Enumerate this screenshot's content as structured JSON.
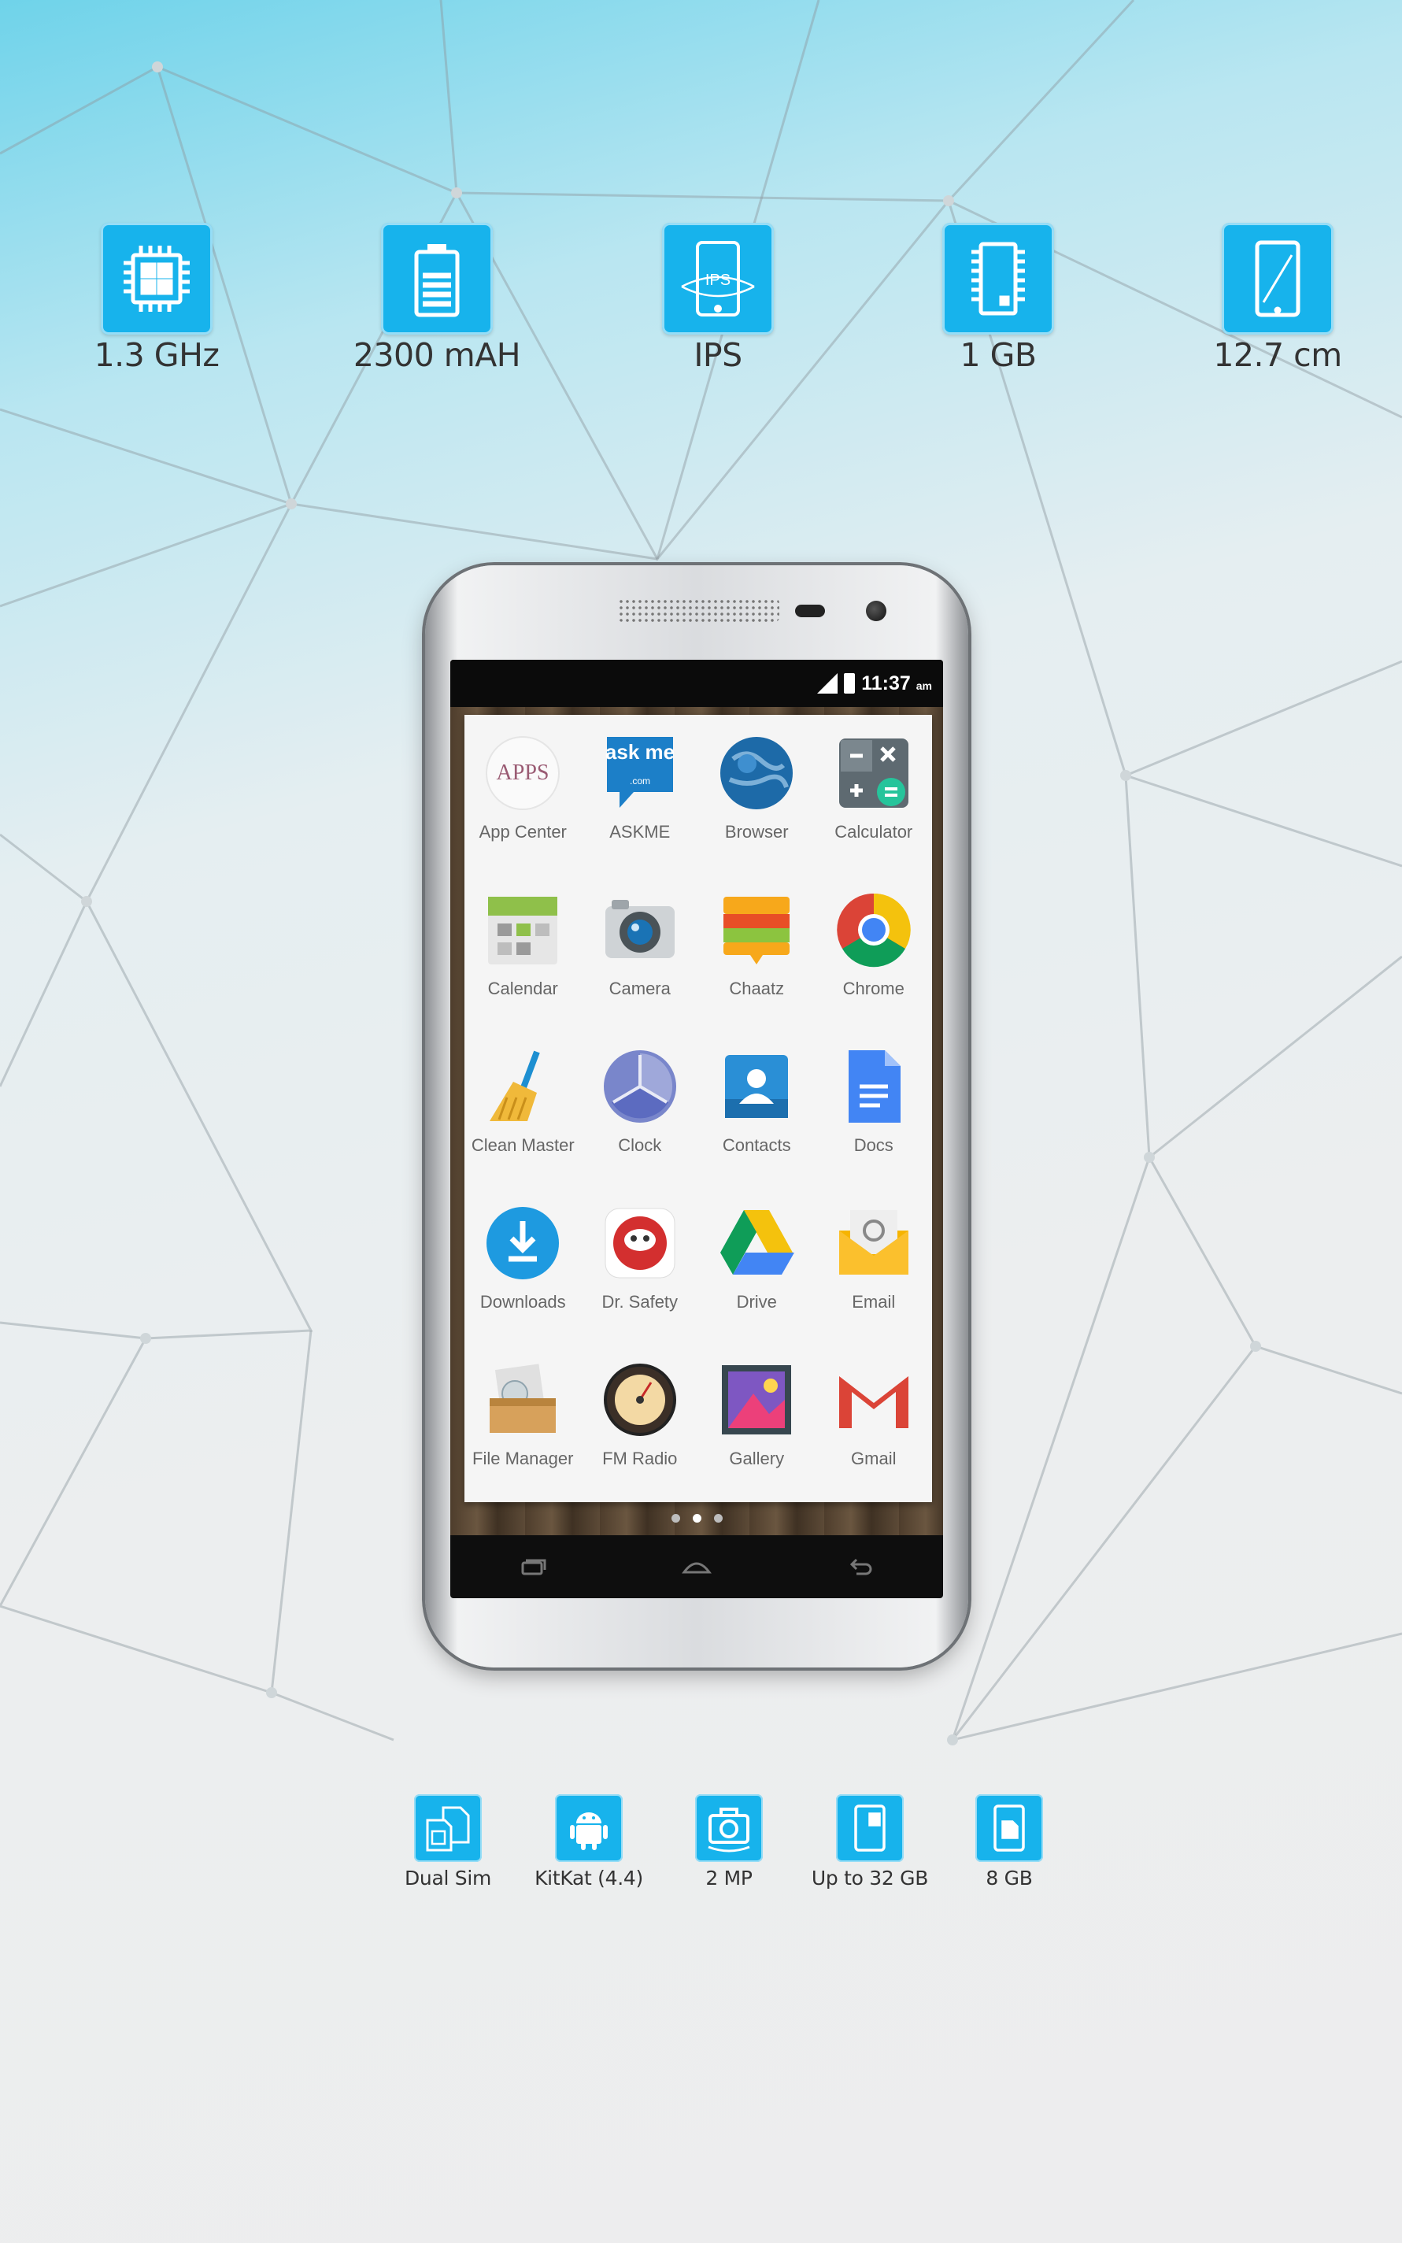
{
  "top_specs": [
    {
      "icon": "processor-chip-icon",
      "label": "1.3 GHz"
    },
    {
      "icon": "battery-icon",
      "label": "2300 mAH"
    },
    {
      "icon": "ips-display-icon",
      "label": "IPS",
      "icon_text": "IPS"
    },
    {
      "icon": "memory-ram-icon",
      "label": "1 GB"
    },
    {
      "icon": "screen-size-icon",
      "label": "12.7 cm"
    }
  ],
  "bottom_specs": [
    {
      "icon": "dual-sim-icon",
      "label": "Dual Sim"
    },
    {
      "icon": "android-icon",
      "label": "KitKat (4.4)"
    },
    {
      "icon": "front-camera-icon",
      "label": "2 MP"
    },
    {
      "icon": "expandable-memory-icon",
      "label": "Up to 32 GB"
    },
    {
      "icon": "storage-card-icon",
      "label": "8 GB"
    }
  ],
  "phone": {
    "status_time": "11:37",
    "status_ampm": "am",
    "apps": [
      {
        "name": "App Center",
        "icon": "app-center-icon",
        "icon_text": "APPS"
      },
      {
        "name": "ASKME",
        "icon": "askme-icon",
        "icon_text": "ask me",
        "icon_subtext": ".com"
      },
      {
        "name": "Browser",
        "icon": "browser-globe-icon"
      },
      {
        "name": "Calculator",
        "icon": "calculator-icon"
      },
      {
        "name": "Calendar",
        "icon": "calendar-icon"
      },
      {
        "name": "Camera",
        "icon": "camera-icon"
      },
      {
        "name": "Chaatz",
        "icon": "chaatz-icon"
      },
      {
        "name": "Chrome",
        "icon": "chrome-icon"
      },
      {
        "name": "Clean Master",
        "icon": "clean-master-broom-icon"
      },
      {
        "name": "Clock",
        "icon": "clock-icon"
      },
      {
        "name": "Contacts",
        "icon": "contacts-icon"
      },
      {
        "name": "Docs",
        "icon": "docs-icon"
      },
      {
        "name": "Downloads",
        "icon": "downloads-icon"
      },
      {
        "name": "Dr. Safety",
        "icon": "dr-safety-icon"
      },
      {
        "name": "Drive",
        "icon": "drive-icon"
      },
      {
        "name": "Email",
        "icon": "email-icon"
      },
      {
        "name": "File Manager",
        "icon": "file-manager-icon"
      },
      {
        "name": "FM Radio",
        "icon": "fm-radio-icon"
      },
      {
        "name": "Gallery",
        "icon": "gallery-icon"
      },
      {
        "name": "Gmail",
        "icon": "gmail-icon"
      }
    ],
    "page_indicator": {
      "count": 3,
      "current": 1
    },
    "nav_buttons": [
      "recent-apps-icon",
      "home-icon",
      "back-icon"
    ]
  },
  "colors": {
    "spec_icon_bg": "#17b3ec",
    "label_text": "#333333",
    "app_label": "#666666"
  }
}
